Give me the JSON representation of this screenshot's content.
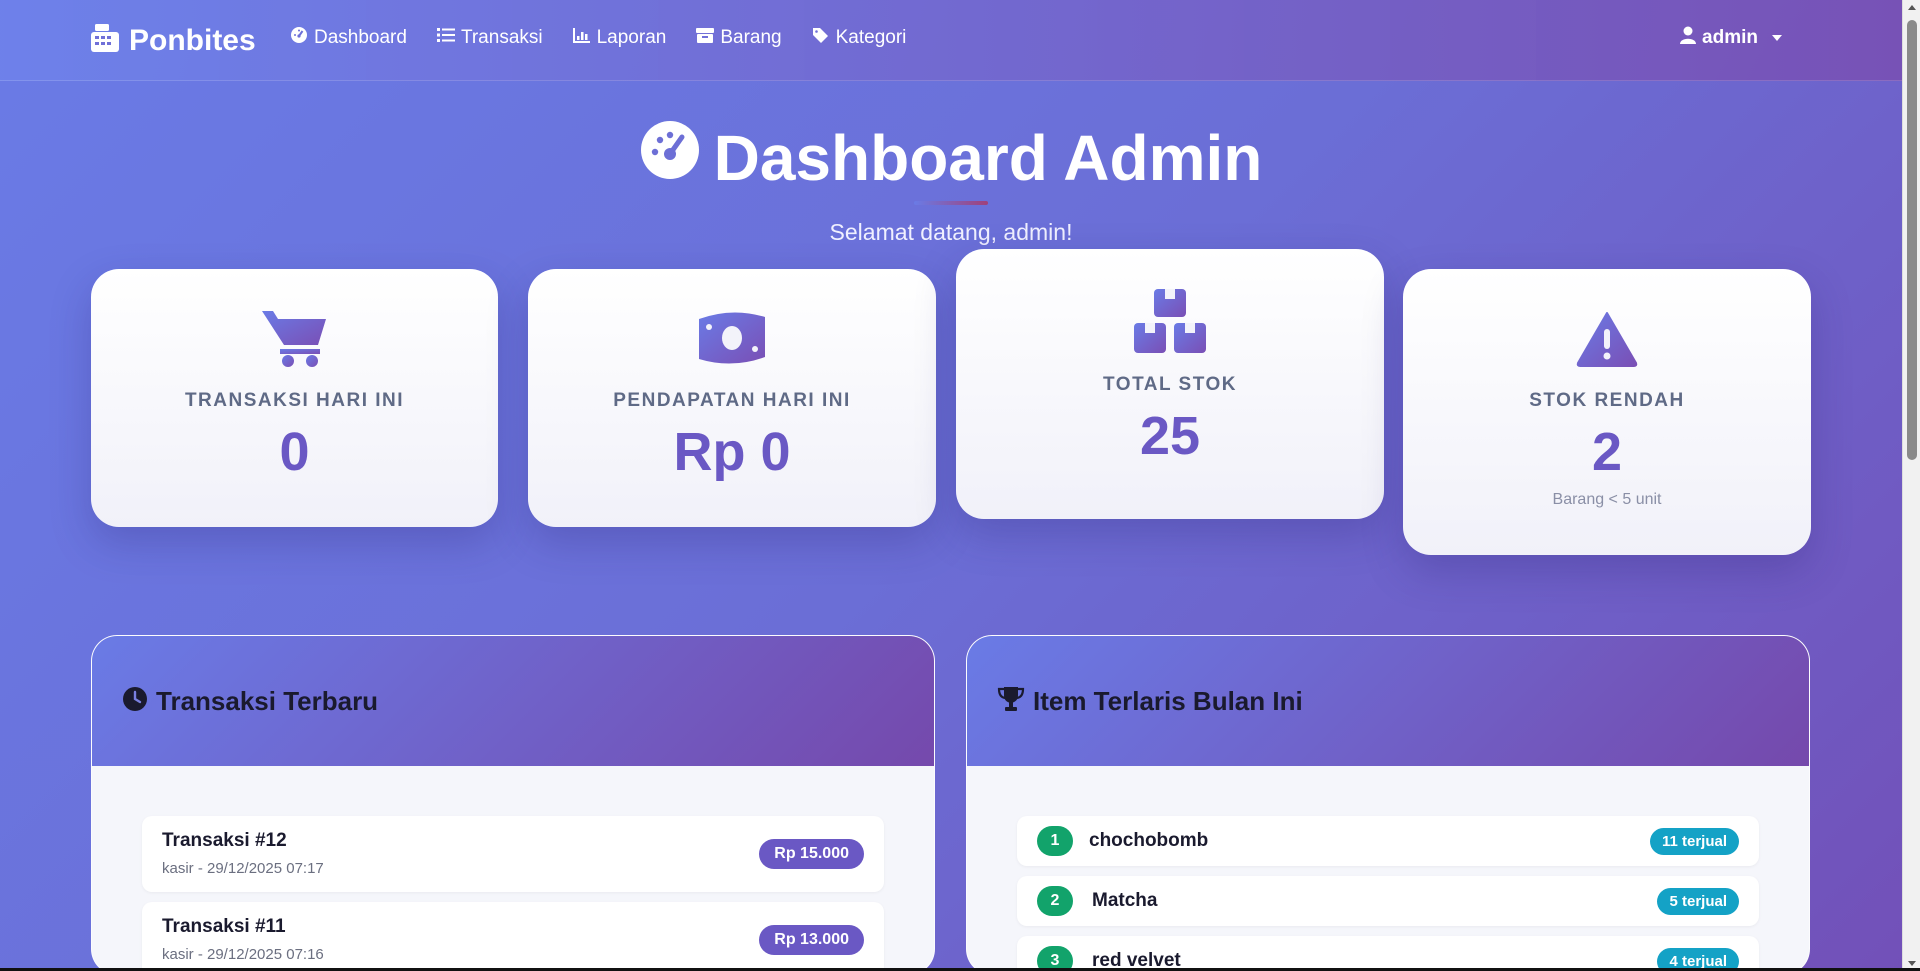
{
  "nav": {
    "brand": "Ponbites",
    "links": [
      {
        "label": "Dashboard",
        "icon": "gauge-icon"
      },
      {
        "label": "Transaksi",
        "icon": "list-icon"
      },
      {
        "label": "Laporan",
        "icon": "chart-icon"
      },
      {
        "label": "Barang",
        "icon": "box-icon"
      },
      {
        "label": "Kategori",
        "icon": "tags-icon"
      }
    ],
    "user": "admin"
  },
  "header": {
    "title": "Dashboard Admin",
    "subtitle": "Selamat datang, admin!"
  },
  "stats": [
    {
      "label": "TRANSAKSI HARI INI",
      "value": "0",
      "icon": "cart-icon"
    },
    {
      "label": "PENDAPATAN HARI INI",
      "value": "Rp 0",
      "icon": "money-icon"
    },
    {
      "label": "TOTAL STOK",
      "value": "25",
      "icon": "boxes-icon"
    },
    {
      "label": "STOK RENDAH",
      "value": "2",
      "note": "Barang < 5 unit",
      "icon": "warning-icon"
    }
  ],
  "recent": {
    "title": "Transaksi Terbaru",
    "items": [
      {
        "title": "Transaksi #12",
        "meta": "kasir - 29/12/2025 07:17",
        "amount": "Rp 15.000"
      },
      {
        "title": "Transaksi #11",
        "meta": "kasir - 29/12/2025 07:16",
        "amount": "Rp 13.000"
      }
    ]
  },
  "top": {
    "title": "Item Terlaris Bulan Ini",
    "items": [
      {
        "rank": "1",
        "name": "chochobomb",
        "sold": "11 terjual"
      },
      {
        "rank": "2",
        "name": "Matcha",
        "sold": "5 terjual"
      },
      {
        "rank": "3",
        "name": "red velvet",
        "sold": "4 terjual"
      }
    ]
  },
  "colors": {
    "accent": "#6a58c4",
    "rank_badge": "#12a36b",
    "sold_badge": "#14a2c6"
  }
}
